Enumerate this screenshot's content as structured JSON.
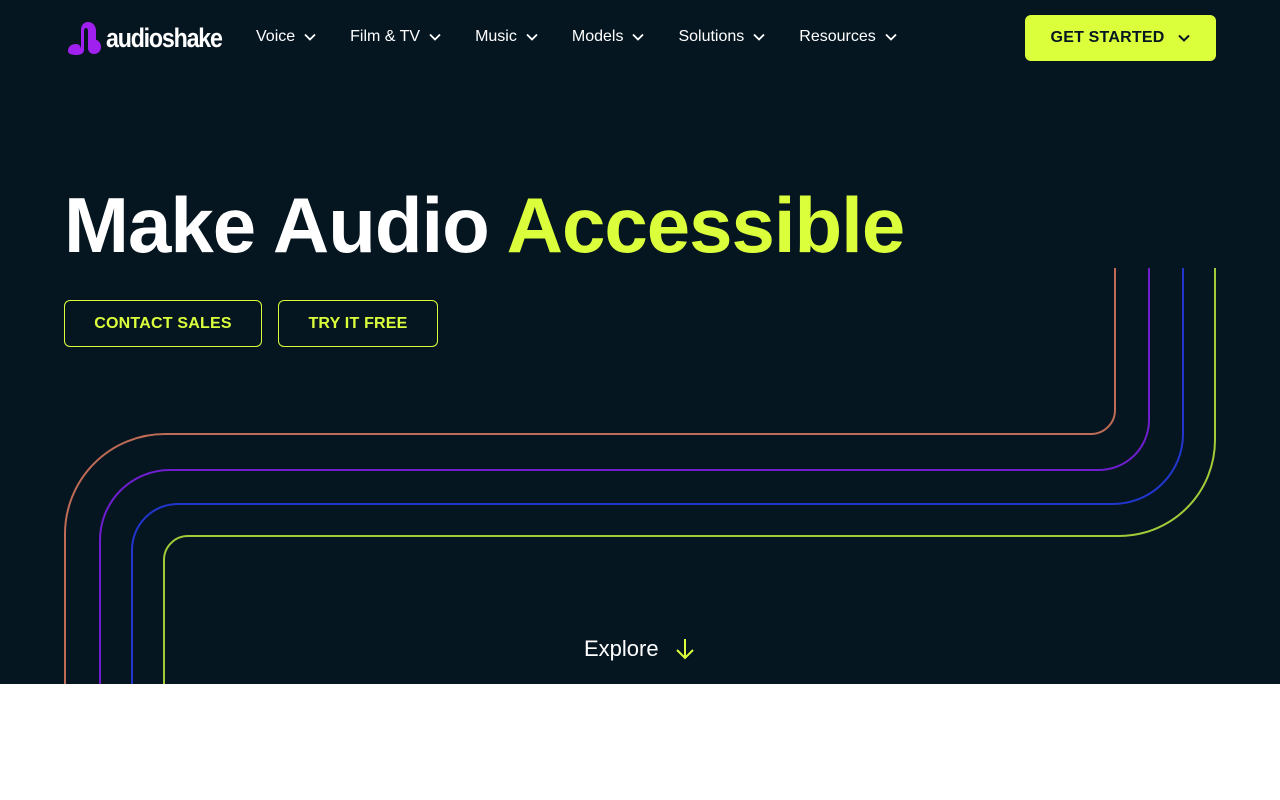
{
  "brand": {
    "name": "audioshake",
    "logo_color": "#a020f0"
  },
  "nav": {
    "items": [
      {
        "label": "Voice",
        "icon": "chevron-down-icon"
      },
      {
        "label": "Film & TV",
        "icon": "chevron-down-icon"
      },
      {
        "label": "Music",
        "icon": "chevron-down-icon"
      },
      {
        "label": "Models",
        "icon": "chevron-down-icon"
      },
      {
        "label": "Solutions",
        "icon": "chevron-down-icon"
      },
      {
        "label": "Resources",
        "icon": "chevron-down-icon"
      }
    ],
    "cta_label": "GET STARTED"
  },
  "hero": {
    "headline_main": "Make Audio ",
    "headline_accent": "Accessible",
    "contact_label": "CONTACT SALES",
    "try_label": "TRY IT FREE",
    "explore_label": "Explore"
  },
  "colors": {
    "background": "#051621",
    "accent": "#dcff3c",
    "text": "#ffffff",
    "line_1": "#e07a5f",
    "line_2": "#7b1fe0",
    "line_3": "#2438d8",
    "line_4": "#b6dd3c"
  }
}
